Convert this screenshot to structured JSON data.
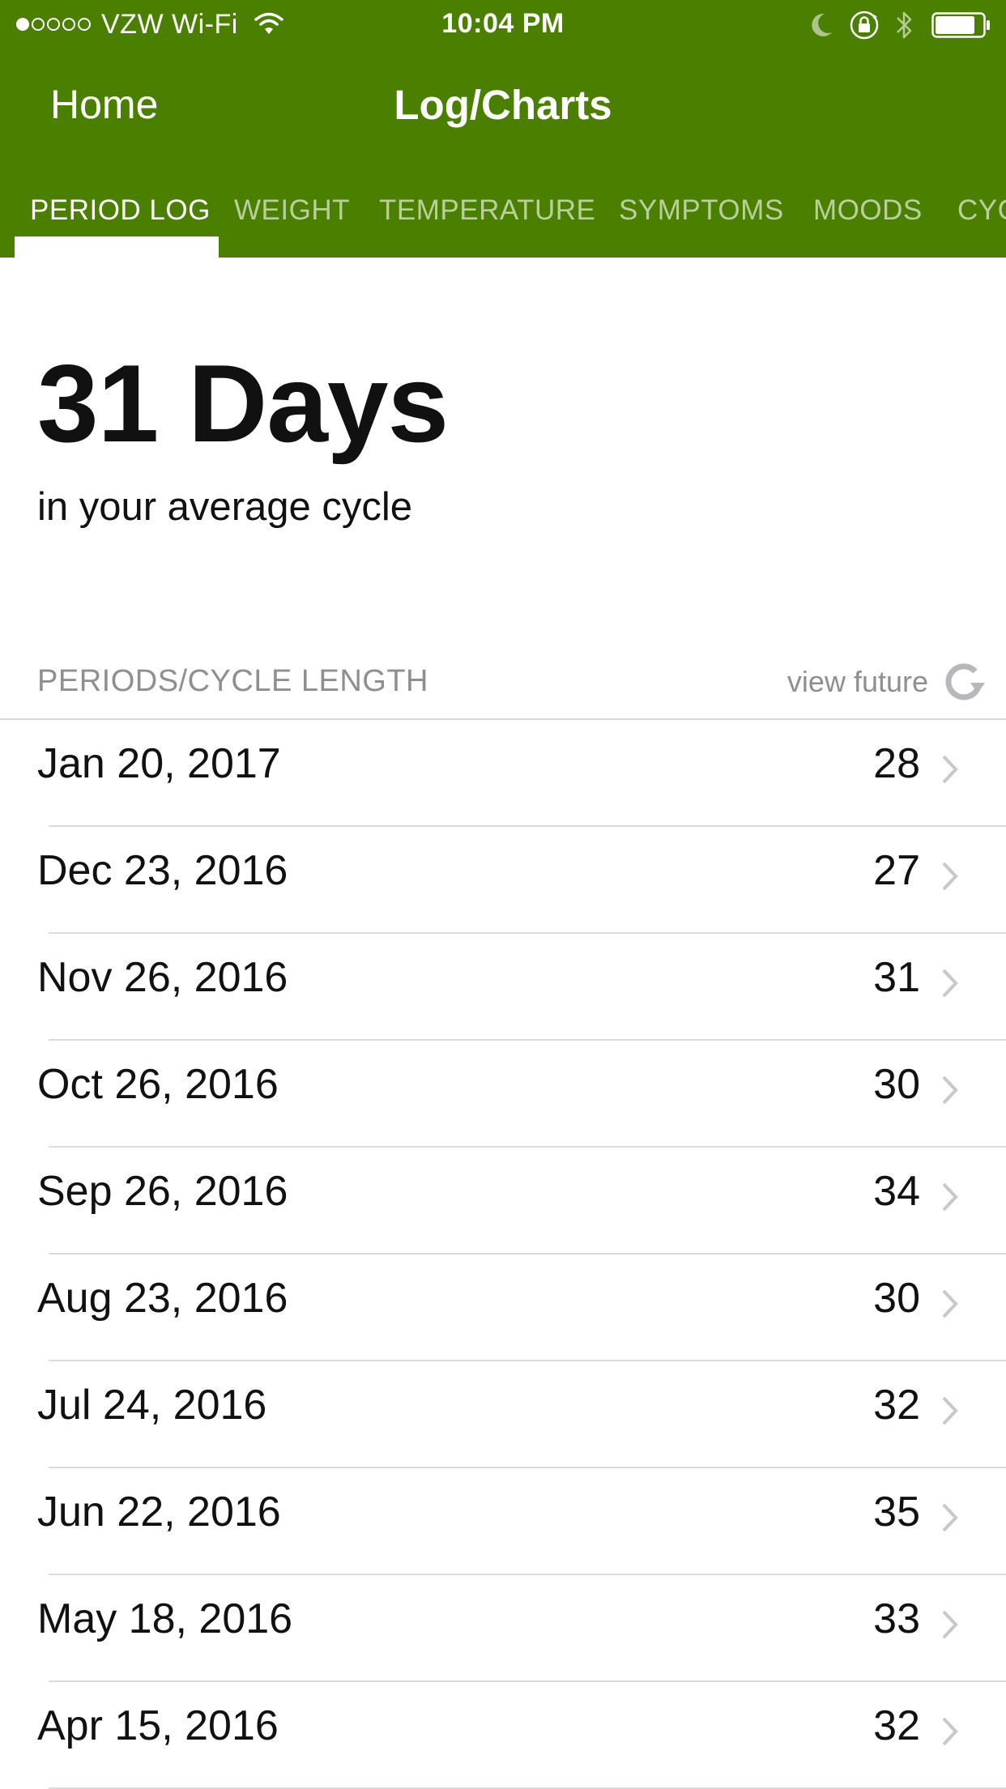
{
  "status_bar": {
    "carrier": "VZW Wi-Fi",
    "signal_bars_filled": 1,
    "signal_bars_total": 5,
    "time": "10:04 PM",
    "battery_level": 0.85,
    "icons": [
      "wifi-icon",
      "moon-icon",
      "lock-rotation-icon",
      "bluetooth-icon",
      "battery-icon"
    ]
  },
  "nav": {
    "back_label": "Home",
    "title": "Log/Charts"
  },
  "tabs": [
    {
      "label": "PERIOD LOG",
      "active": true
    },
    {
      "label": "WEIGHT",
      "active": false
    },
    {
      "label": "TEMPERATURE",
      "active": false
    },
    {
      "label": "SYMPTOMS",
      "active": false
    },
    {
      "label": "MOODS",
      "active": false
    },
    {
      "label": "CYC",
      "active": false
    }
  ],
  "summary": {
    "value": "31 Days",
    "caption": "in your average cycle"
  },
  "section": {
    "title": "PERIODS/CYCLE LENGTH",
    "view_future_label": "view future",
    "view_future_icon": "refresh-icon"
  },
  "periods": [
    {
      "date": "Jan 20, 2017",
      "length": "28"
    },
    {
      "date": "Dec 23, 2016",
      "length": "27"
    },
    {
      "date": "Nov 26, 2016",
      "length": "31"
    },
    {
      "date": "Oct 26, 2016",
      "length": "30"
    },
    {
      "date": "Sep 26, 2016",
      "length": "34"
    },
    {
      "date": "Aug 23, 2016",
      "length": "30"
    },
    {
      "date": "Jul 24, 2016",
      "length": "32"
    },
    {
      "date": "Jun 22, 2016",
      "length": "35"
    },
    {
      "date": "May 18, 2016",
      "length": "33"
    },
    {
      "date": "Apr 15, 2016",
      "length": "32"
    }
  ],
  "colors": {
    "header_green": "#4a7f00",
    "secondary_text": "#8e8e93",
    "primary_text": "#111111",
    "divider": "#dcdcdc"
  }
}
